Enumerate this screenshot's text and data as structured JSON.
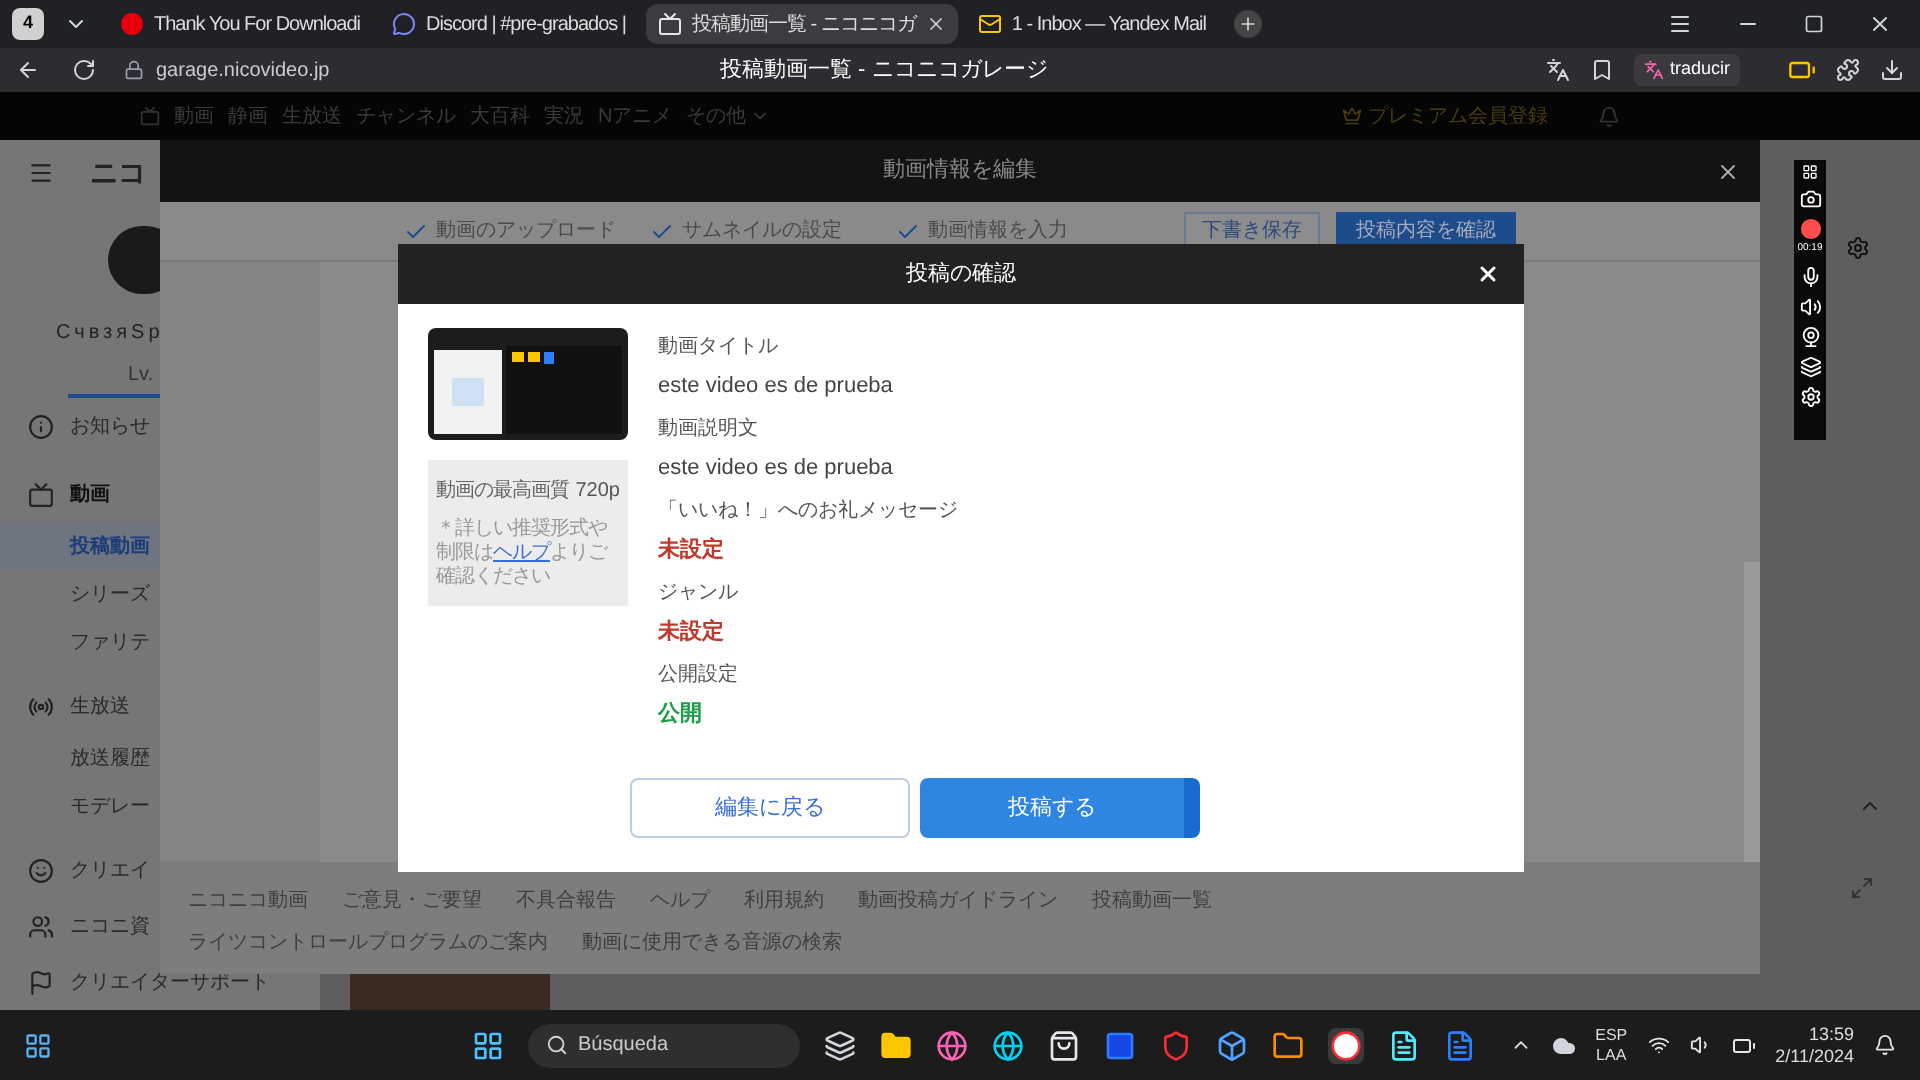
{
  "browser": {
    "tab_count": "4",
    "tabs": [
      {
        "title": "Thank You For Downloadi",
        "selected": false,
        "kind": "record"
      },
      {
        "title": "Discord | #pre-grabados |",
        "selected": false,
        "kind": "chat"
      },
      {
        "title": "投稿動画一覧 - ニコニコガ",
        "selected": true,
        "kind": "page"
      },
      {
        "title": "1 - Inbox — Yandex Mail",
        "selected": false,
        "kind": "mail"
      }
    ],
    "address": "garage.nicovideo.jp",
    "page_title": "投稿動画一覧 - ニコニコガレージ",
    "translate_button": "traducir"
  },
  "site_nav": {
    "links": [
      "動画",
      "静画",
      "生放送",
      "チャンネル",
      "大百科",
      "実況",
      "Nアニメ",
      "その他"
    ],
    "premium": "プレミアム会員登録"
  },
  "sidebar": {
    "logo": "ニコ",
    "user": "СчвзяSp",
    "level": "Lv.",
    "items": [
      {
        "label": "お知らせ",
        "kind": "info",
        "selected": false
      },
      {
        "label": "動画",
        "kind": "video",
        "selected": false
      },
      {
        "label": "投稿動画",
        "kind": "sub",
        "selected": true
      },
      {
        "label": "シリーズ",
        "kind": "sub",
        "selected": false
      },
      {
        "label": "ファリテ",
        "kind": "sub",
        "selected": false
      },
      {
        "label": "生放送",
        "kind": "live",
        "selected": false
      },
      {
        "label": "放送履歴",
        "kind": "sub",
        "selected": false
      },
      {
        "label": "モデレー",
        "kind": "sub",
        "selected": false
      },
      {
        "label": "クリエイ",
        "kind": "creator",
        "selected": false
      },
      {
        "label": "ニコニ資",
        "kind": "asset",
        "selected": false
      },
      {
        "label": "クリエイターサポート",
        "kind": "support",
        "selected": false
      }
    ]
  },
  "edit_dialog": {
    "title": "動画情報を編集",
    "steps": [
      {
        "label": "動画のアップロード",
        "done": true
      },
      {
        "label": "サムネイルの設定",
        "done": true
      },
      {
        "label": "動画情報を入力",
        "done": true
      }
    ],
    "draft_button": "下書き保存",
    "confirm_button": "投稿内容を確認",
    "footer_links": [
      "ニコニコ動画",
      "ご意見・ご要望",
      "不具合報告",
      "ヘルプ",
      "利用規約",
      "動画投稿ガイドライン",
      "投稿動画一覧"
    ],
    "footer_links_2": [
      "ライツコントロールプログラムのご案内",
      "動画に使用できる音源の検索"
    ]
  },
  "confirm_dialog": {
    "title": "投稿の確認",
    "quality_label": "動画の最高画質",
    "quality_value": "720p",
    "note": "＊詳しい推奨形式や制限は",
    "help_link": "ヘルプ",
    "note_tail": "よりご確認ください",
    "fields": [
      {
        "label": "動画タイトル",
        "value": "este video es de prueba",
        "kind": "text"
      },
      {
        "label": "動画説明文",
        "value": "este video es de prueba",
        "kind": "text"
      },
      {
        "label": "「いいね！」へのお礼メッセージ",
        "value": "未設定",
        "kind": "unset"
      },
      {
        "label": "ジャンル",
        "value": "未設定",
        "kind": "unset"
      },
      {
        "label": "公開設定",
        "value": "公開",
        "kind": "public"
      }
    ],
    "back_button": "編集に戻る",
    "submit_button": "投稿する"
  },
  "recorder": {
    "timer": "00:19"
  },
  "taskbar": {
    "search": "Búsqueda",
    "language": "ESP",
    "layout": "LAA",
    "time": "13:59",
    "date": "2/11/2024"
  }
}
